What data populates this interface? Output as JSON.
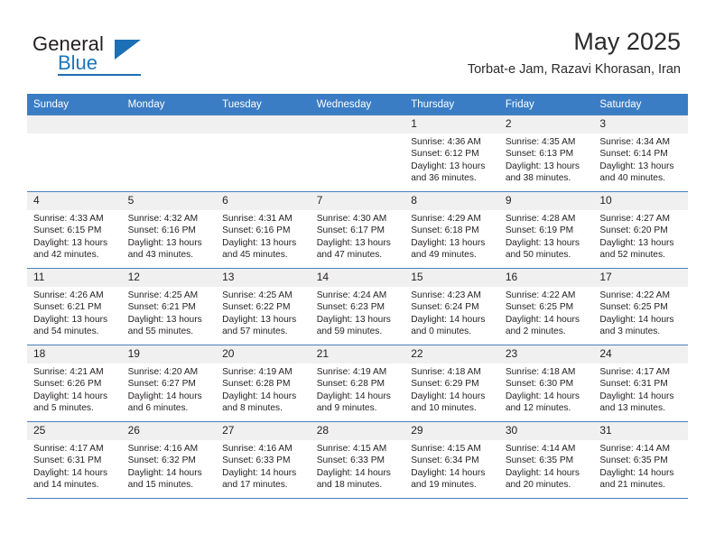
{
  "brand": {
    "name_part1": "General",
    "name_part2": "Blue",
    "icon": "triangle-flag-logo"
  },
  "header": {
    "month_title": "May 2025",
    "location": "Torbat-e Jam, Razavi Khorasan, Iran"
  },
  "colors": {
    "header_blue": "#3b7dc4",
    "grid_blue": "#4a7fbb",
    "daynum_bg": "#f0f0f0",
    "brand_blue": "#1c75bc"
  },
  "weekdays": [
    "Sunday",
    "Monday",
    "Tuesday",
    "Wednesday",
    "Thursday",
    "Friday",
    "Saturday"
  ],
  "weeks": [
    [
      {
        "day": "",
        "sunrise": "",
        "sunset": "",
        "daylight1": "",
        "daylight2": ""
      },
      {
        "day": "",
        "sunrise": "",
        "sunset": "",
        "daylight1": "",
        "daylight2": ""
      },
      {
        "day": "",
        "sunrise": "",
        "sunset": "",
        "daylight1": "",
        "daylight2": ""
      },
      {
        "day": "",
        "sunrise": "",
        "sunset": "",
        "daylight1": "",
        "daylight2": ""
      },
      {
        "day": "1",
        "sunrise": "Sunrise: 4:36 AM",
        "sunset": "Sunset: 6:12 PM",
        "daylight1": "Daylight: 13 hours",
        "daylight2": "and 36 minutes."
      },
      {
        "day": "2",
        "sunrise": "Sunrise: 4:35 AM",
        "sunset": "Sunset: 6:13 PM",
        "daylight1": "Daylight: 13 hours",
        "daylight2": "and 38 minutes."
      },
      {
        "day": "3",
        "sunrise": "Sunrise: 4:34 AM",
        "sunset": "Sunset: 6:14 PM",
        "daylight1": "Daylight: 13 hours",
        "daylight2": "and 40 minutes."
      }
    ],
    [
      {
        "day": "4",
        "sunrise": "Sunrise: 4:33 AM",
        "sunset": "Sunset: 6:15 PM",
        "daylight1": "Daylight: 13 hours",
        "daylight2": "and 42 minutes."
      },
      {
        "day": "5",
        "sunrise": "Sunrise: 4:32 AM",
        "sunset": "Sunset: 6:16 PM",
        "daylight1": "Daylight: 13 hours",
        "daylight2": "and 43 minutes."
      },
      {
        "day": "6",
        "sunrise": "Sunrise: 4:31 AM",
        "sunset": "Sunset: 6:16 PM",
        "daylight1": "Daylight: 13 hours",
        "daylight2": "and 45 minutes."
      },
      {
        "day": "7",
        "sunrise": "Sunrise: 4:30 AM",
        "sunset": "Sunset: 6:17 PM",
        "daylight1": "Daylight: 13 hours",
        "daylight2": "and 47 minutes."
      },
      {
        "day": "8",
        "sunrise": "Sunrise: 4:29 AM",
        "sunset": "Sunset: 6:18 PM",
        "daylight1": "Daylight: 13 hours",
        "daylight2": "and 49 minutes."
      },
      {
        "day": "9",
        "sunrise": "Sunrise: 4:28 AM",
        "sunset": "Sunset: 6:19 PM",
        "daylight1": "Daylight: 13 hours",
        "daylight2": "and 50 minutes."
      },
      {
        "day": "10",
        "sunrise": "Sunrise: 4:27 AM",
        "sunset": "Sunset: 6:20 PM",
        "daylight1": "Daylight: 13 hours",
        "daylight2": "and 52 minutes."
      }
    ],
    [
      {
        "day": "11",
        "sunrise": "Sunrise: 4:26 AM",
        "sunset": "Sunset: 6:21 PM",
        "daylight1": "Daylight: 13 hours",
        "daylight2": "and 54 minutes."
      },
      {
        "day": "12",
        "sunrise": "Sunrise: 4:25 AM",
        "sunset": "Sunset: 6:21 PM",
        "daylight1": "Daylight: 13 hours",
        "daylight2": "and 55 minutes."
      },
      {
        "day": "13",
        "sunrise": "Sunrise: 4:25 AM",
        "sunset": "Sunset: 6:22 PM",
        "daylight1": "Daylight: 13 hours",
        "daylight2": "and 57 minutes."
      },
      {
        "day": "14",
        "sunrise": "Sunrise: 4:24 AM",
        "sunset": "Sunset: 6:23 PM",
        "daylight1": "Daylight: 13 hours",
        "daylight2": "and 59 minutes."
      },
      {
        "day": "15",
        "sunrise": "Sunrise: 4:23 AM",
        "sunset": "Sunset: 6:24 PM",
        "daylight1": "Daylight: 14 hours",
        "daylight2": "and 0 minutes."
      },
      {
        "day": "16",
        "sunrise": "Sunrise: 4:22 AM",
        "sunset": "Sunset: 6:25 PM",
        "daylight1": "Daylight: 14 hours",
        "daylight2": "and 2 minutes."
      },
      {
        "day": "17",
        "sunrise": "Sunrise: 4:22 AM",
        "sunset": "Sunset: 6:25 PM",
        "daylight1": "Daylight: 14 hours",
        "daylight2": "and 3 minutes."
      }
    ],
    [
      {
        "day": "18",
        "sunrise": "Sunrise: 4:21 AM",
        "sunset": "Sunset: 6:26 PM",
        "daylight1": "Daylight: 14 hours",
        "daylight2": "and 5 minutes."
      },
      {
        "day": "19",
        "sunrise": "Sunrise: 4:20 AM",
        "sunset": "Sunset: 6:27 PM",
        "daylight1": "Daylight: 14 hours",
        "daylight2": "and 6 minutes."
      },
      {
        "day": "20",
        "sunrise": "Sunrise: 4:19 AM",
        "sunset": "Sunset: 6:28 PM",
        "daylight1": "Daylight: 14 hours",
        "daylight2": "and 8 minutes."
      },
      {
        "day": "21",
        "sunrise": "Sunrise: 4:19 AM",
        "sunset": "Sunset: 6:28 PM",
        "daylight1": "Daylight: 14 hours",
        "daylight2": "and 9 minutes."
      },
      {
        "day": "22",
        "sunrise": "Sunrise: 4:18 AM",
        "sunset": "Sunset: 6:29 PM",
        "daylight1": "Daylight: 14 hours",
        "daylight2": "and 10 minutes."
      },
      {
        "day": "23",
        "sunrise": "Sunrise: 4:18 AM",
        "sunset": "Sunset: 6:30 PM",
        "daylight1": "Daylight: 14 hours",
        "daylight2": "and 12 minutes."
      },
      {
        "day": "24",
        "sunrise": "Sunrise: 4:17 AM",
        "sunset": "Sunset: 6:31 PM",
        "daylight1": "Daylight: 14 hours",
        "daylight2": "and 13 minutes."
      }
    ],
    [
      {
        "day": "25",
        "sunrise": "Sunrise: 4:17 AM",
        "sunset": "Sunset: 6:31 PM",
        "daylight1": "Daylight: 14 hours",
        "daylight2": "and 14 minutes."
      },
      {
        "day": "26",
        "sunrise": "Sunrise: 4:16 AM",
        "sunset": "Sunset: 6:32 PM",
        "daylight1": "Daylight: 14 hours",
        "daylight2": "and 15 minutes."
      },
      {
        "day": "27",
        "sunrise": "Sunrise: 4:16 AM",
        "sunset": "Sunset: 6:33 PM",
        "daylight1": "Daylight: 14 hours",
        "daylight2": "and 17 minutes."
      },
      {
        "day": "28",
        "sunrise": "Sunrise: 4:15 AM",
        "sunset": "Sunset: 6:33 PM",
        "daylight1": "Daylight: 14 hours",
        "daylight2": "and 18 minutes."
      },
      {
        "day": "29",
        "sunrise": "Sunrise: 4:15 AM",
        "sunset": "Sunset: 6:34 PM",
        "daylight1": "Daylight: 14 hours",
        "daylight2": "and 19 minutes."
      },
      {
        "day": "30",
        "sunrise": "Sunrise: 4:14 AM",
        "sunset": "Sunset: 6:35 PM",
        "daylight1": "Daylight: 14 hours",
        "daylight2": "and 20 minutes."
      },
      {
        "day": "31",
        "sunrise": "Sunrise: 4:14 AM",
        "sunset": "Sunset: 6:35 PM",
        "daylight1": "Daylight: 14 hours",
        "daylight2": "and 21 minutes."
      }
    ]
  ]
}
